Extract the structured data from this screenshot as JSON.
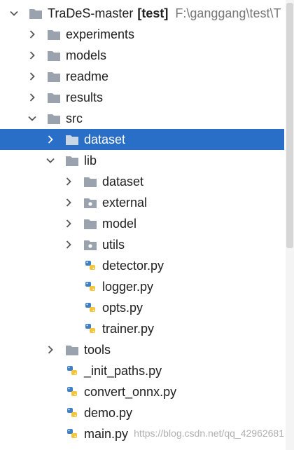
{
  "tree": {
    "root": {
      "label": "TraDeS-master",
      "tag": "[test]",
      "path": "F:\\ganggang\\test\\T"
    },
    "items": [
      {
        "label": "experiments"
      },
      {
        "label": "models"
      },
      {
        "label": "readme"
      },
      {
        "label": "results"
      },
      {
        "label": "src"
      },
      {
        "label": "dataset"
      },
      {
        "label": "lib"
      },
      {
        "label": "dataset"
      },
      {
        "label": "external"
      },
      {
        "label": "model"
      },
      {
        "label": "utils"
      },
      {
        "label": "detector.py"
      },
      {
        "label": "logger.py"
      },
      {
        "label": "opts.py"
      },
      {
        "label": "trainer.py"
      },
      {
        "label": "tools"
      },
      {
        "label": "_init_paths.py"
      },
      {
        "label": "convert_onnx.py"
      },
      {
        "label": "demo.py"
      },
      {
        "label": "main.py"
      }
    ]
  },
  "watermark": "https://blog.csdn.net/qq_42962681",
  "colors": {
    "selection": "#2a6fc7",
    "folder": "#9aa3ad",
    "python_blue": "#3f7fc4",
    "python_yellow": "#f2c53d"
  },
  "icons": {
    "folder": "folder-icon",
    "package": "package-folder-icon",
    "python": "python-file-icon",
    "collapsed": "chevron-right-icon",
    "expanded": "chevron-down-icon"
  }
}
